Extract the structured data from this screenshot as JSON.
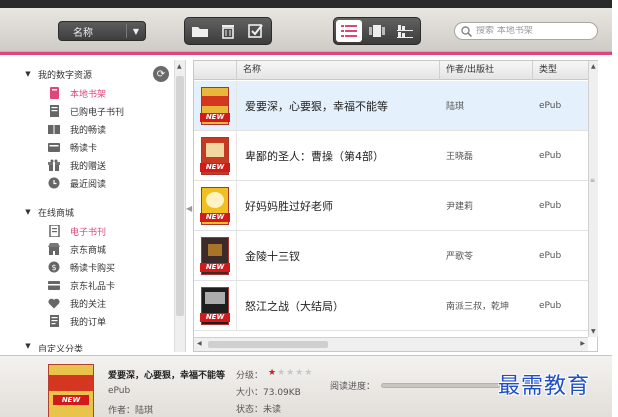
{
  "toolbar": {
    "sort_label": "名称",
    "search_placeholder": "搜索 本地书架"
  },
  "sidebar": {
    "section1": "我的数字资源",
    "section1_items": [
      {
        "label": "本地书架",
        "icon": "bookshelf-icon",
        "active": true
      },
      {
        "label": "已购电子书刊",
        "icon": "purchased-icon"
      },
      {
        "label": "我的畅读",
        "icon": "open-book-icon"
      },
      {
        "label": "畅读卡",
        "icon": "card-icon"
      },
      {
        "label": "我的赠送",
        "icon": "gift-icon"
      },
      {
        "label": "最近阅读",
        "icon": "clock-icon"
      }
    ],
    "section2": "在线商城",
    "section2_items": [
      {
        "label": "电子书刊",
        "icon": "ebook-icon",
        "active": true
      },
      {
        "label": "京东商城",
        "icon": "store-icon"
      },
      {
        "label": "畅读卡购买",
        "icon": "card-buy-icon"
      },
      {
        "label": "京东礼品卡",
        "icon": "gift-card-icon"
      },
      {
        "label": "我的关注",
        "icon": "heart-icon"
      },
      {
        "label": "我的订单",
        "icon": "order-icon"
      }
    ],
    "section3_partial": "自定义分类"
  },
  "table": {
    "columns": [
      "名称",
      "作者/出版社",
      "类型"
    ],
    "rows": [
      {
        "title": "爱要深，心要狠，幸福不能等",
        "author": "陆琪",
        "type": "ePub",
        "cover_color": "#e8b83a",
        "selected": true
      },
      {
        "title": "卑鄙的圣人：曹操（第4部）",
        "author": "王晓磊",
        "type": "ePub",
        "cover_color": "#c63a22"
      },
      {
        "title": "好妈妈胜过好老师",
        "author": "尹建莉",
        "type": "ePub",
        "cover_color": "#f0c020"
      },
      {
        "title": "金陵十三钗",
        "author": "严歌苓",
        "type": "ePub",
        "cover_color": "#3a2a2a"
      },
      {
        "title": "怒江之战（大结局）",
        "author": "南派三叔，乾坤",
        "type": "ePub",
        "cover_color": "#1e1e1e"
      }
    ],
    "new_badge": "NEW"
  },
  "detail": {
    "title": "爱要深，心要狠，幸福不能等",
    "type": "ePub",
    "author_label": "作者：",
    "author": "陆琪",
    "rating_label": "分级：",
    "rating": 1,
    "rating_max": 5,
    "size_label": "大小：",
    "size": "73.09KB",
    "status_label": "状态：",
    "status": "未读",
    "progress_label": "阅读进度：",
    "progress": 0
  },
  "watermark": "最需教育",
  "colors": {
    "accent": "#e0457a",
    "selected_row": "#e4f0fb",
    "new_badge": "#d21a1a"
  }
}
